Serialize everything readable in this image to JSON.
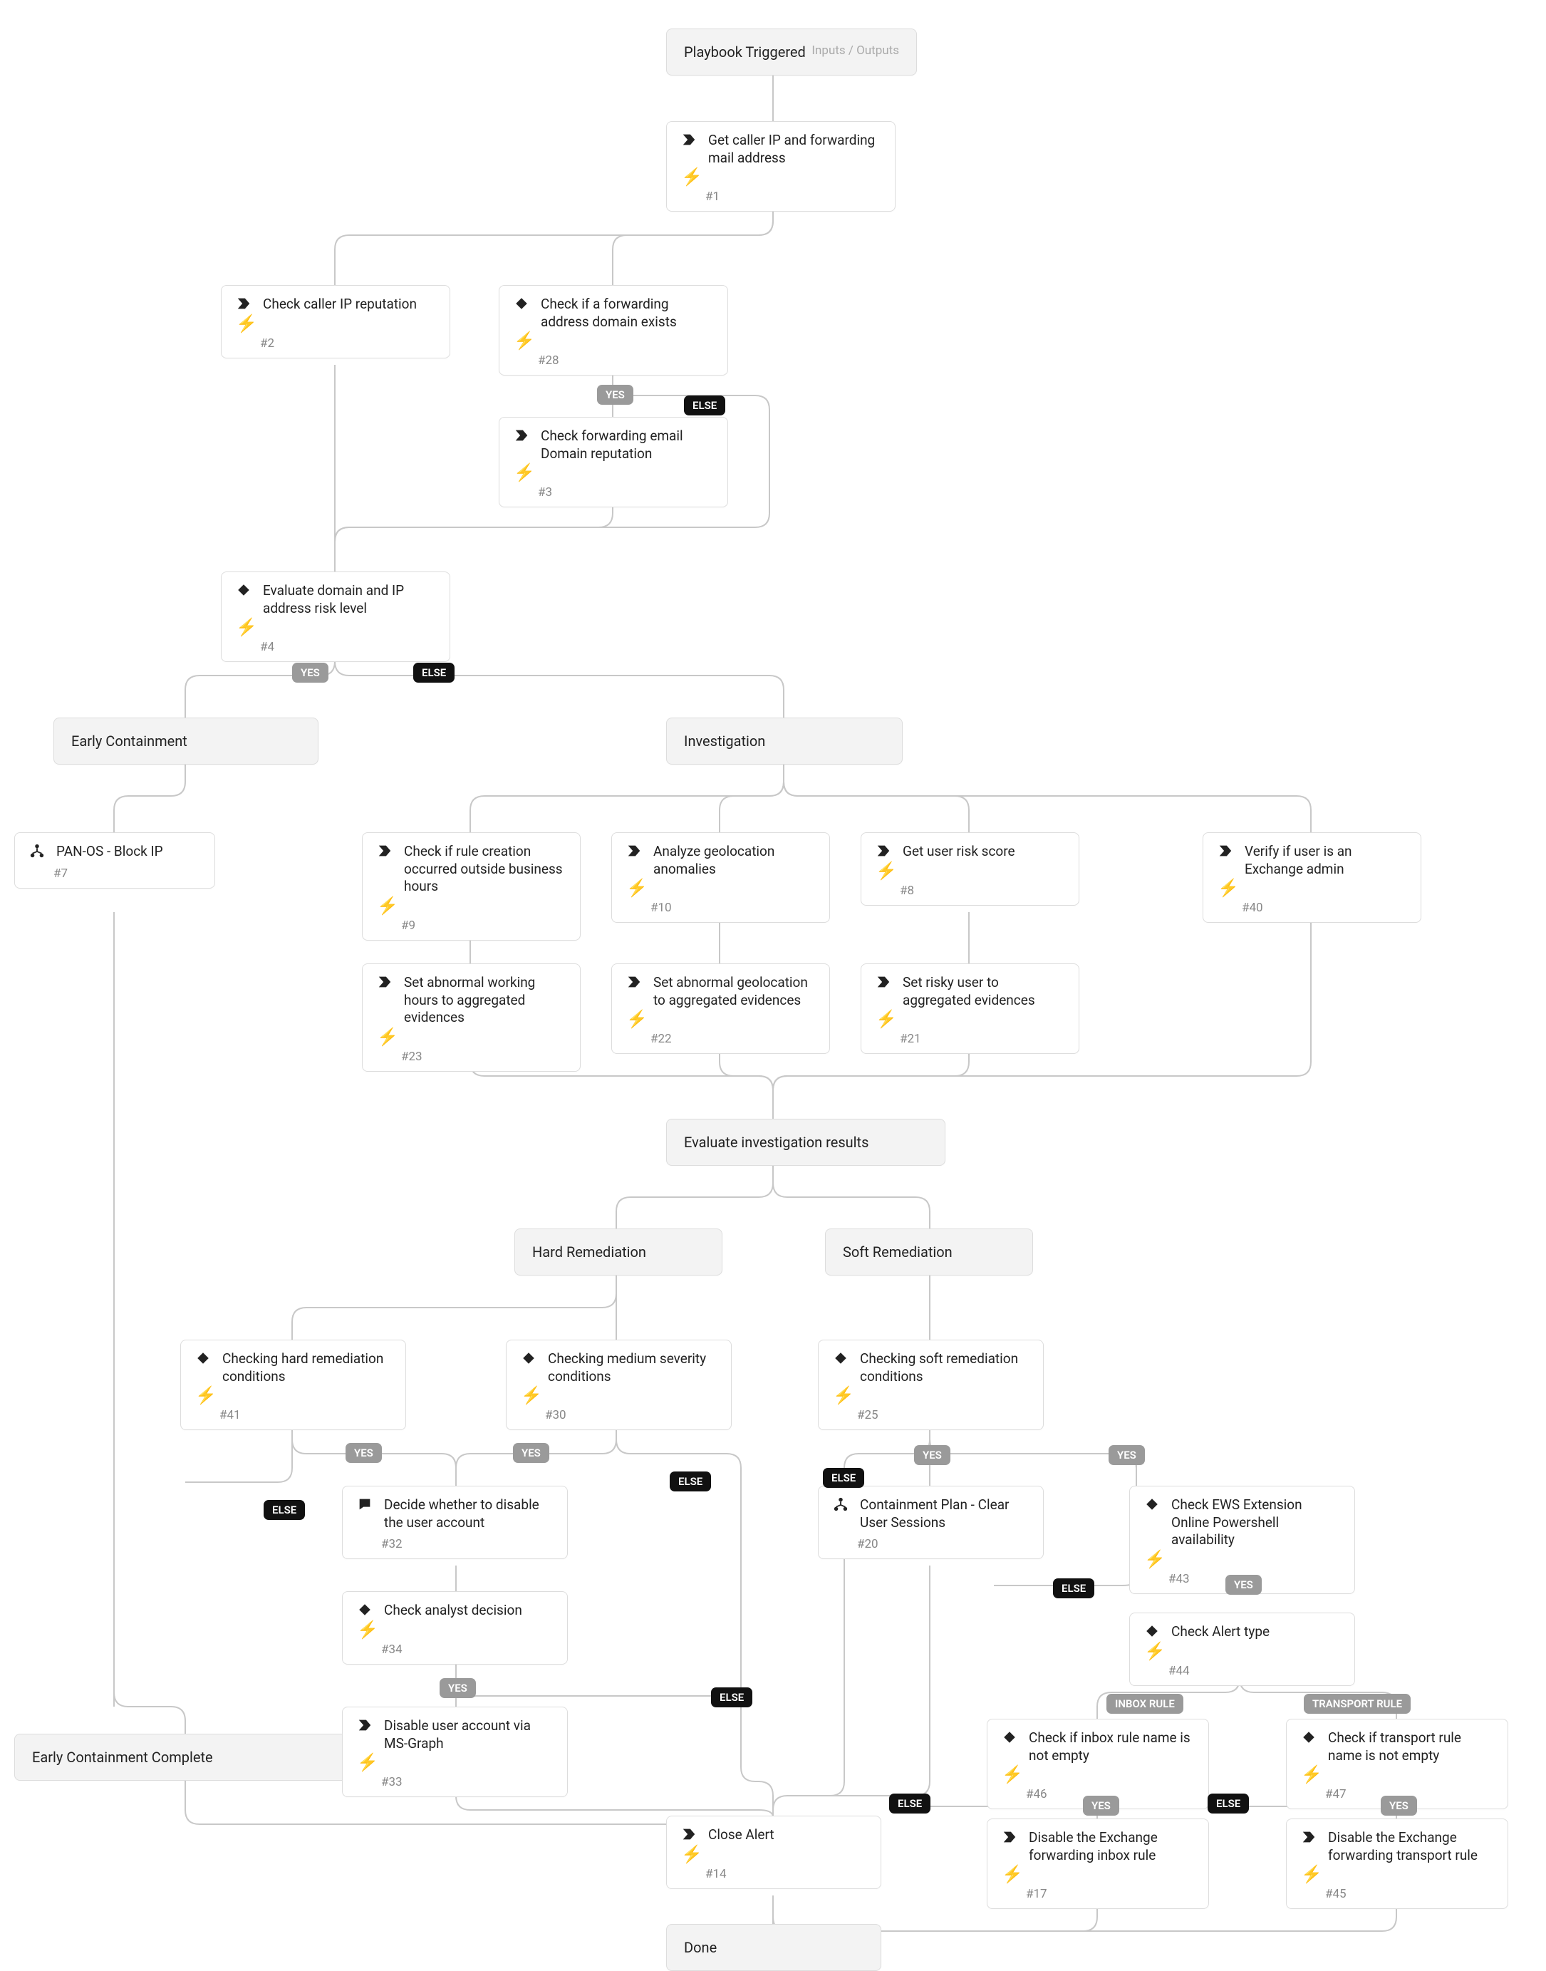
{
  "labels": {
    "inputs_outputs": "Inputs / Outputs",
    "yes": "YES",
    "else": "ELSE",
    "inbox": "INBOX RULE",
    "transport": "TRANSPORT RULE"
  },
  "headers": {
    "triggered": "Playbook Triggered",
    "early_containment": "Early Containment",
    "investigation": "Investigation",
    "evaluate": "Evaluate investigation results",
    "hard": "Hard Remediation",
    "soft": "Soft Remediation",
    "early_complete": "Early Containment Complete",
    "done": "Done"
  },
  "steps": {
    "s1": {
      "t": "Get caller IP and forwarding mail address",
      "n": "#1"
    },
    "s2": {
      "t": "Check caller IP reputation",
      "n": "#2"
    },
    "s28": {
      "t": "Check if a forwarding address domain exists",
      "n": "#28"
    },
    "s3": {
      "t": "Check forwarding email Domain reputation",
      "n": "#3"
    },
    "s4": {
      "t": "Evaluate domain and IP address risk level",
      "n": "#4"
    },
    "s7": {
      "t": "PAN-OS - Block IP",
      "n": "#7"
    },
    "s9": {
      "t": "Check if rule creation occurred outside business hours",
      "n": "#9"
    },
    "s10": {
      "t": "Analyze geolocation anomalies",
      "n": "#10"
    },
    "s8": {
      "t": "Get user risk score",
      "n": "#8"
    },
    "s40": {
      "t": "Verify if user is an Exchange admin",
      "n": "#40"
    },
    "s23": {
      "t": "Set abnormal working hours to aggregated evidences",
      "n": "#23"
    },
    "s22": {
      "t": "Set abnormal geolocation to aggregated evidences",
      "n": "#22"
    },
    "s21": {
      "t": "Set risky user to aggregated evidences",
      "n": "#21"
    },
    "s41": {
      "t": "Checking hard remediation conditions",
      "n": "#41"
    },
    "s30": {
      "t": "Checking medium severity conditions",
      "n": "#30"
    },
    "s25": {
      "t": "Checking soft remediation conditions",
      "n": "#25"
    },
    "s32": {
      "t": "Decide whether to disable the user account",
      "n": "#32"
    },
    "s20": {
      "t": "Containment Plan - Clear User Sessions",
      "n": "#20"
    },
    "s43": {
      "t": "Check EWS Extension Online Powershell availability",
      "n": "#43"
    },
    "s34": {
      "t": "Check analyst decision",
      "n": "#34"
    },
    "s44": {
      "t": "Check Alert type",
      "n": "#44"
    },
    "s33": {
      "t": "Disable user account via MS-Graph",
      "n": "#33"
    },
    "s46": {
      "t": "Check if inbox rule name is not empty",
      "n": "#46"
    },
    "s47": {
      "t": "Check if transport rule name is not empty",
      "n": "#47"
    },
    "s17": {
      "t": "Disable the Exchange forwarding inbox rule",
      "n": "#17"
    },
    "s45": {
      "t": "Disable the Exchange forwarding transport rule",
      "n": "#45"
    },
    "s14": {
      "t": "Close Alert",
      "n": "#14"
    }
  }
}
